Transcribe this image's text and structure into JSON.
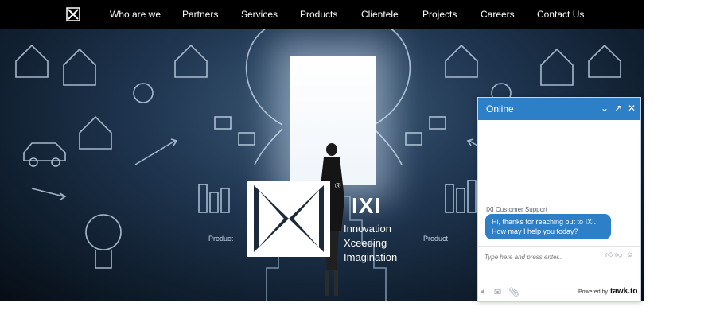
{
  "nav": {
    "logo_icon": "ixi-logo-icon",
    "items": [
      "Who are we",
      "Partners",
      "Services",
      "Products",
      "Clientele",
      "Projects",
      "Careers",
      "Contact Us"
    ]
  },
  "hero": {
    "brand_word": "IXI",
    "registered": "®",
    "tagline": [
      "Innovation",
      "Xceeding",
      "Imagination"
    ],
    "sketch_labels": [
      "Product",
      "Product"
    ]
  },
  "chat": {
    "status": "Online",
    "controls": [
      "chevron-down-icon",
      "expand-icon",
      "close-icon"
    ],
    "agent_name": "IXI Customer Support",
    "agent_message": "Hi, thanks for reaching out to IXI. How may I help you today?",
    "input_placeholder": "Type here and press enter..",
    "powered_by": "Powered by",
    "brand": "tawk.to"
  },
  "colors": {
    "accent": "#2d7fc7",
    "nav_bg": "#000000",
    "hero_dark": "#0d1a28"
  }
}
